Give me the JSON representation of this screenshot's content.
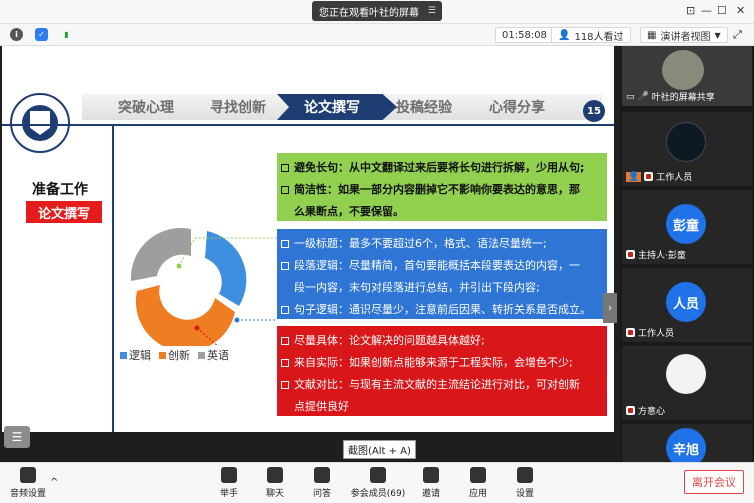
{
  "title_bar": {
    "share_banner": "您正在观看叶社的屏幕"
  },
  "toolbar": {
    "timer": "01:58:08",
    "viewers": "118人看过",
    "view_mode": "演讲者视图"
  },
  "slide": {
    "nav_items": [
      "突破心理",
      "寻找创新",
      "论文撰写",
      "投稿经验",
      "心得分享"
    ],
    "active_nav": "论文撰写",
    "page_number": "15",
    "prep_title": "准备工作",
    "prep_tag": "论文撰写",
    "green_box": {
      "line1": "避免长句：从中文翻译过来后要将长句进行拆解，少用从句;",
      "line2": "简洁性：如果一部分内容删掉它不影响你要表达的意思，那",
      "line2b": "么果断点，不要保留。"
    },
    "blue_box": {
      "line1": "一级标题：最多不要超过6个，格式、语法尽量统一;",
      "line2": "段落逻辑：尽量精简，首句要能概括本段要表达的内容，一",
      "line2b": "段一内容，末句对段落进行总结，并引出下段内容;",
      "line3": "句子逻辑：通识尽量少，注意前后因果、转折关系是否成立。"
    },
    "red_box": {
      "line1": "尽量具体：论文解决的问题越具体越好;",
      "line2": "来自实际：如果创新点能够来源于工程实际，会增色不少;",
      "line3": "文献对比：与现有主流文献的主流结论进行对比，可对创新",
      "line3b": "点提供良好"
    },
    "legend": [
      "逻辑",
      "创新",
      "英语"
    ],
    "screenshot_tip": "截图(Alt + A)"
  },
  "participants": [
    {
      "name": "叶社的屏幕共享",
      "type": "photo"
    },
    {
      "name": "工作人员",
      "type": "photo"
    },
    {
      "name": "主持人·彭童",
      "avatar": "彭童",
      "type": "avatar"
    },
    {
      "name": "工作人员",
      "avatar": "人员",
      "type": "avatar"
    },
    {
      "name": "方意心",
      "type": "photo"
    },
    {
      "name": "",
      "avatar": "辛旭",
      "type": "avatar"
    }
  ],
  "bottom_bar": {
    "audio": "音频设置",
    "raise_hand": "举手",
    "chat": "聊天",
    "qa": "问答",
    "members": "参会成员(69)",
    "invite": "邀请",
    "apps": "应用",
    "settings": "设置",
    "leave": "离开会议"
  },
  "colors": {
    "nav_active": "#1e3d73",
    "green": "#92d050",
    "blue": "#2e75d6",
    "red": "#d9171b",
    "avatar_blue": "#1f72e8"
  }
}
